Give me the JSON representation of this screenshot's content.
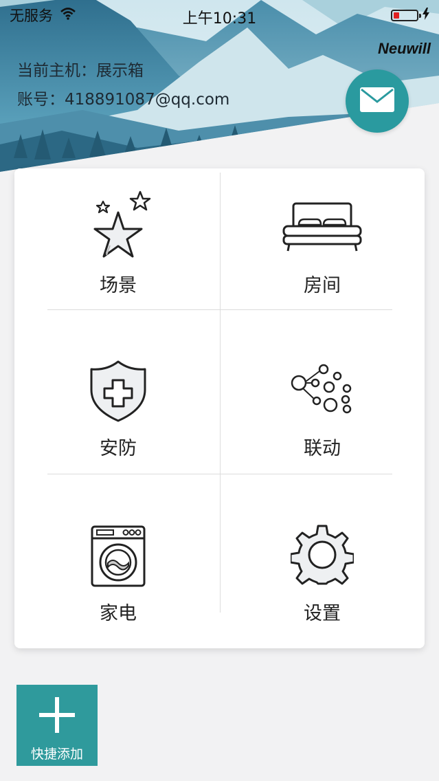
{
  "status_bar": {
    "carrier": "无服务",
    "time": "上午10:31"
  },
  "header": {
    "brand": "Neuwill",
    "host_label": "当前主机：展示箱",
    "account_label": "账号：418891087@qq.com"
  },
  "menu": [
    {
      "label": "场景",
      "icon": "star-icon"
    },
    {
      "label": "房间",
      "icon": "bed-icon"
    },
    {
      "label": "安防",
      "icon": "shield-icon"
    },
    {
      "label": "联动",
      "icon": "link-icon"
    },
    {
      "label": "家电",
      "icon": "washing-machine-icon"
    },
    {
      "label": "设置",
      "icon": "gear-icon"
    }
  ],
  "quick_add": {
    "label": "快捷添加",
    "icon": "plus-icon"
  },
  "colors": {
    "accent": "#2a9a9f",
    "background": "#f2f2f3",
    "battery": "#e02020"
  }
}
